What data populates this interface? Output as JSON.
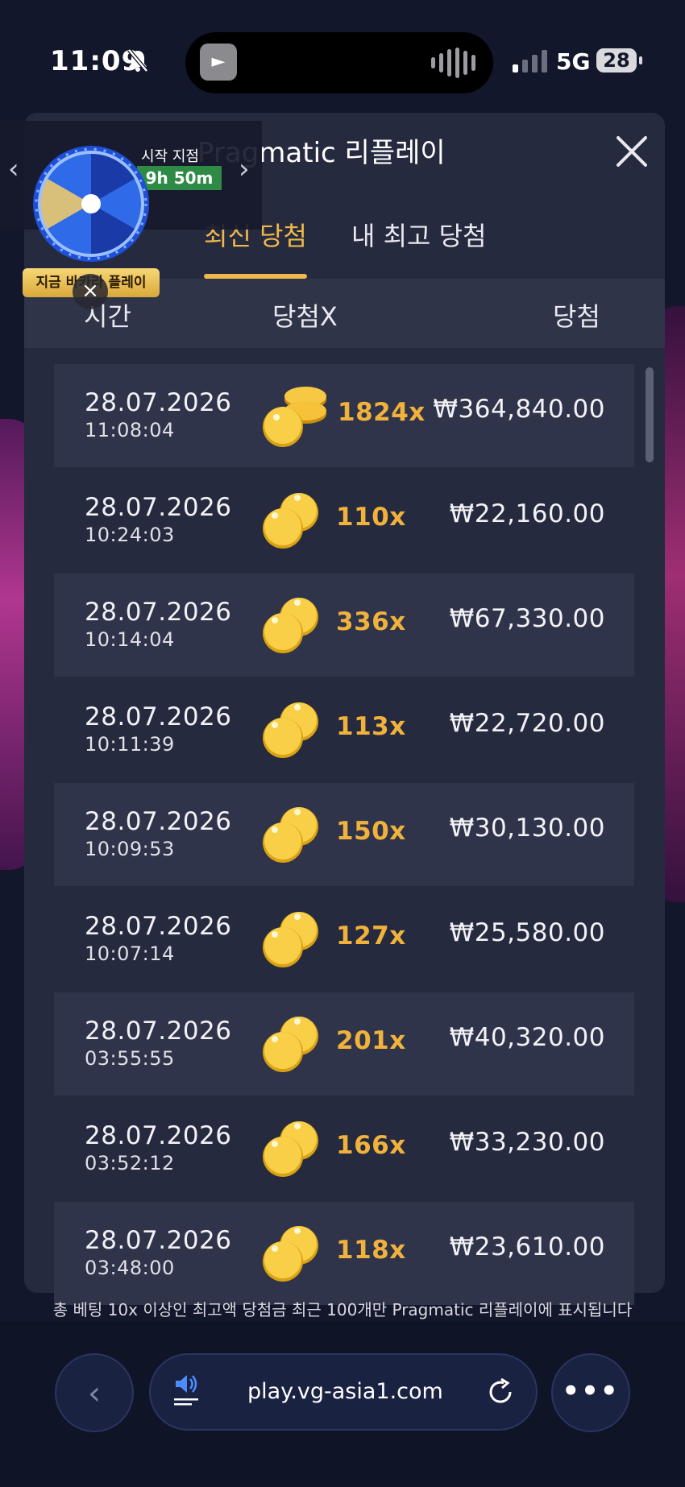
{
  "status": {
    "time": "11:09",
    "network": "5G",
    "battery": "28"
  },
  "promo": {
    "label": "시작 지점",
    "timer": "9h 50m",
    "badge": "지금 바카라 플레이"
  },
  "modal": {
    "title": "Pragmatic 리플레이",
    "tabs": [
      "최신 당첨",
      "내 최고 당첨"
    ],
    "columns": [
      "시간",
      "당첨X",
      "당첨"
    ],
    "rows": [
      {
        "date": "28.07.2026",
        "time": "11:08:04",
        "mult": "1824x",
        "amount": "₩364,840.00"
      },
      {
        "date": "28.07.2026",
        "time": "10:24:03",
        "mult": "110x",
        "amount": "₩22,160.00"
      },
      {
        "date": "28.07.2026",
        "time": "10:14:04",
        "mult": "336x",
        "amount": "₩67,330.00"
      },
      {
        "date": "28.07.2026",
        "time": "10:11:39",
        "mult": "113x",
        "amount": "₩22,720.00"
      },
      {
        "date": "28.07.2026",
        "time": "10:09:53",
        "mult": "150x",
        "amount": "₩30,130.00"
      },
      {
        "date": "28.07.2026",
        "time": "10:07:14",
        "mult": "127x",
        "amount": "₩25,580.00"
      },
      {
        "date": "28.07.2026",
        "time": "03:55:55",
        "mult": "201x",
        "amount": "₩40,320.00"
      },
      {
        "date": "28.07.2026",
        "time": "03:52:12",
        "mult": "166x",
        "amount": "₩33,230.00"
      },
      {
        "date": "28.07.2026",
        "time": "03:48:00",
        "mult": "118x",
        "amount": "₩23,610.00"
      }
    ],
    "footnote": "총 베팅 10x 이상인 최고액 당첨금 최근 100개만 Pragmatic 리플레이에 표시됩니다"
  },
  "browser": {
    "url": "play.vg-asia1.com"
  },
  "icons": {
    "bell": "bell-slash-icon",
    "close": "close-icon",
    "coins": "coins-icon",
    "back": "chevron-left-icon",
    "audio": "speaker-icon",
    "reload": "reload-icon",
    "more": "more-icon"
  },
  "colors": {
    "accent": "#f0b84a",
    "multiplier": "#f1b23c",
    "panel": "#252a3f",
    "timer_bg": "#2e8b46"
  }
}
